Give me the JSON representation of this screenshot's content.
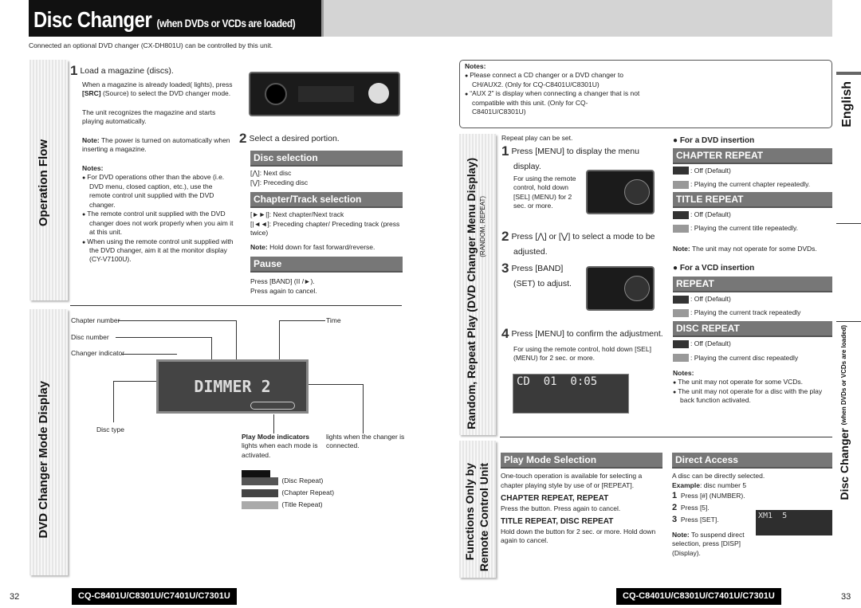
{
  "header": {
    "title": "Disc Changer",
    "subtitle": "(when DVDs or VCDs are loaded)",
    "intro": "Connected an optional DVD changer (CX-DH801U) can be controlled by this unit."
  },
  "left": {
    "operation_flow": {
      "tab": "Operation Flow",
      "step1_num": "1",
      "step1_title": "Load a magazine (discs).",
      "step1_text_a": "When a magazine is already loaded(  lights), press",
      "step1_text_b_bold": "[SRC]",
      "step1_text_b": " (Source) to select the DVD changer mode.",
      "step1_text2": "The unit recognizes the magazine and starts playing automatically.",
      "note_label": "Note:",
      "note": " The power is turned on automatically when inserting a magazine.",
      "notes_label": "Notes:",
      "notes": [
        "For DVD operations other than the above (i.e. DVD menu, closed caption, etc.), use the remote control unit supplied with the DVD changer.",
        "The remote control unit supplied with the DVD changer does not work properly when you aim it at this unit.",
        "When using the remote control unit supplied with the DVD changer, aim it at the monitor display (CY-V7100U)."
      ],
      "step2_num": "2",
      "step2_title": "Select a desired portion.",
      "disc_selection": {
        "title": "Disc selection",
        "items": [
          "[⋀]: Next disc",
          "[⋁]: Preceding disc"
        ]
      },
      "chapter_selection": {
        "title": "Chapter/Track selection",
        "items": [
          "[►►|]: Next chapter/Next track",
          "[|◄◄]: Preceding chapter/ Preceding track (press twice)"
        ],
        "note_label": "Note:",
        "note": " Hold down for fast forward/reverse."
      },
      "pause": {
        "title": "Pause",
        "line1": "Press [BAND] (II /►).",
        "line2": "Press again to cancel."
      }
    },
    "mode_display": {
      "tab": "DVD Changer Mode Display",
      "labels": {
        "chapter": "Chapter number",
        "disc": "Disc number",
        "changer": "Changer indicator",
        "time": "Time",
        "disc_type": "Disc type"
      },
      "display_text": "DIMMER 2",
      "play_mode_title": "Play Mode indicators",
      "play_mode_text": "lights when each mode is activated.",
      "changer_text": "lights when the changer is connected.",
      "indicators": [
        "(Disc Repeat)",
        "(Chapter Repeat)",
        "(Title Repeat)"
      ]
    }
  },
  "right": {
    "notes_label": "Notes:",
    "notes": [
      "Please connect a CD changer or a DVD changer to CH/AUX2. (Only for CQ-C8401U/C8301U)",
      "“AUX 2” is display when connecting a changer that is not compatible with this unit. (Only for CQ-C8401U/C8301U)"
    ],
    "repeat": {
      "tab": "Random, Repeat Play (DVD Changer Menu Display)",
      "tab_sub": "(RANDOM, REPEAT)",
      "intro": "Repeat play can be set.",
      "steps": [
        {
          "num": "1",
          "title": "Press [MENU] to display the menu display.",
          "text": "For using the remote control, hold down [SEL] (MENU) for 2 sec. or more."
        },
        {
          "num": "2",
          "title": "Press [⋀] or [⋁] to select a mode to be adjusted."
        },
        {
          "num": "3",
          "title": "Press [BAND] (SET) to adjust."
        },
        {
          "num": "4",
          "title": "Press [MENU] to confirm the adjustment.",
          "text": "For using the remote control, hold down [SEL] (MENU) for 2 sec. or more."
        }
      ],
      "screen_text": "CD  01  0:05",
      "dvd_heading": "For a DVD insertion",
      "vcd_heading": "For a VCD insertion",
      "modes": [
        {
          "title": "CHAPTER REPEAT",
          "off": ": Off (Default)",
          "on": ": Playing the current chapter repeatedly."
        },
        {
          "title": "TITLE REPEAT",
          "off": ": Off (Default)",
          "on": ": Playing the current title repeatedly."
        },
        {
          "title": "REPEAT",
          "off": ": Off (Default)",
          "on": ": Playing the current track repeatedly"
        },
        {
          "title": "DISC REPEAT",
          "off": ": Off  (Default)",
          "on": ": Playing the current disc repeatedly"
        }
      ],
      "dvd_note_label": "Note:",
      "dvd_note": " The unit may not operate for some DVDs.",
      "vcd_notes_label": "Notes:",
      "vcd_notes": [
        "The unit may not operate for some VCDs.",
        "The unit may not operate for a disc with the play back function activated."
      ]
    },
    "remote": {
      "tab1": "Functions Only by",
      "tab2": "Remote Control Unit",
      "play_mode": {
        "title": "Play Mode Selection",
        "intro": "One-touch operation is available for selecting a chapter playing style by use of or [REPEAT].",
        "h1": "CHAPTER REPEAT, REPEAT",
        "t1": "Press the button. Press again to cancel.",
        "h2": "TITLE REPEAT, DISC REPEAT",
        "t2": "Hold down the button for 2 sec. or more. Hold down again to cancel."
      },
      "direct": {
        "title": "Direct Access",
        "intro": "A disc can be directly selected.",
        "example_label": "Example",
        "example": ": disc number 5",
        "steps": [
          {
            "n": "1",
            "t": "Press [#] (NUMBER)."
          },
          {
            "n": "2",
            "t": "Press [5]."
          },
          {
            "n": "3",
            "t": "Press [SET]."
          }
        ],
        "note_label": "Note:",
        "note": " To suspend direct selection, press [DISP] (Display).",
        "screen_text": "XM1  5"
      }
    }
  },
  "side_tabs": {
    "english": "English",
    "disc_changer": "Disc Changer",
    "disc_changer_sub": "(when DVDs or VCDs are loaded)"
  },
  "footer": {
    "page_left": "32",
    "page_right": "33",
    "model": "CQ-C8401U/C8301U/C7401U/C7301U"
  }
}
